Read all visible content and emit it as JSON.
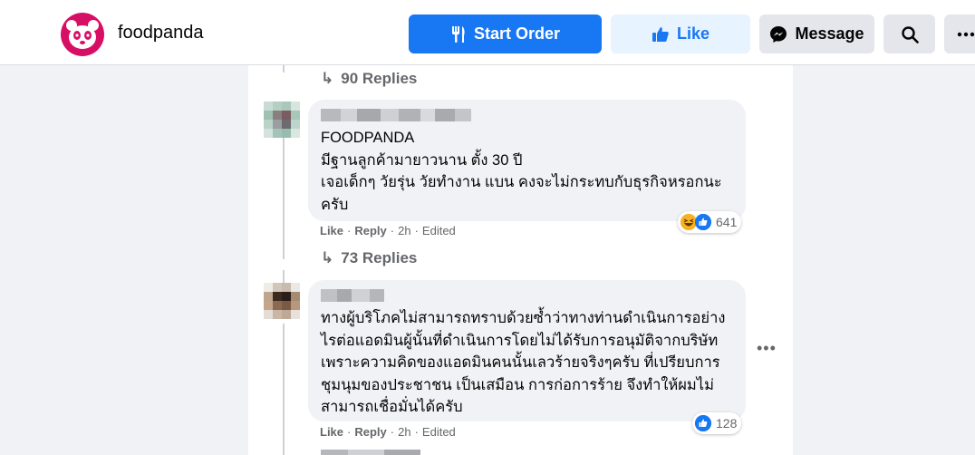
{
  "header": {
    "page_name": "foodpanda",
    "start_order_label": "Start Order",
    "like_label": "Like",
    "message_label": "Message",
    "brand_color": "#d70f64",
    "accent_color": "#1877f2"
  },
  "feed": {
    "top_replies_label": "90 Replies",
    "comments": [
      {
        "text": "FOODPANDA\nมีฐานลูกค้ามายาวนาน ตั้ง 30 ปี\nเจอเด็กๆ วัยรุ่น วัยทำงาน แบน คงจะไม่กระทบกับธุรกิจหรอกนะ\nครับ",
        "like_label": "Like",
        "reply_label": "Reply",
        "time": "2h",
        "edited": "Edited",
        "reaction_count": "641",
        "reaction_icons": [
          "haha-icon",
          "like-icon"
        ],
        "replies_label": "73 Replies"
      },
      {
        "text": "ทางผู้บริโภคไม่สามารถทราบด้วยซ้ำว่าทางท่านดำเนินการอย่าง\nไรต่อแอดมินผู้นั้นที่ดำเนินการโดยไม่ได้รับการอนุมัติจากบริษัท\nเพราะความคิดของแอดมินคนนั้นเลวร้ายจริงๆครับ ที่เปรียบการ\nชุมนุมของประชาชน เป็นเสมือน การก่อการร้าย จึงทำให้ผมไม่\nสามารถเชื่อมั่นได้ครับ",
        "like_label": "Like",
        "reply_label": "Reply",
        "time": "2h",
        "edited": "Edited",
        "reaction_count": "128",
        "reaction_icons": [
          "like-icon"
        ]
      }
    ],
    "bottom_like_label": "Like",
    "bottom_reply_label": "Reply",
    "bottom_time": "2h",
    "bottom_edited": "Edited",
    "sep": "·"
  }
}
